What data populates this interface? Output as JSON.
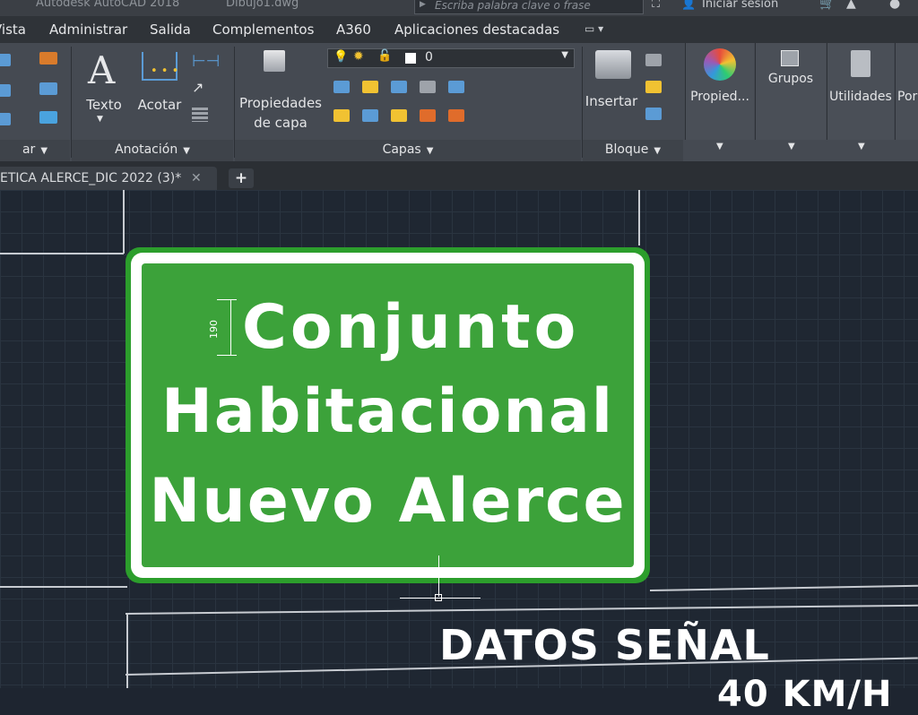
{
  "titlebar": {
    "app_name": "Autodesk AutoCAD 2018",
    "file_name": "Dibujo1.dwg",
    "search_placeholder": "Escriba palabra clave o frase",
    "signin_label": "Iniciar sesión"
  },
  "menu": {
    "items": [
      "Vista",
      "Administrar",
      "Salida",
      "Complementos",
      "A360",
      "Aplicaciones destacadas"
    ]
  },
  "ribbon": {
    "draw_panel_title": "ar",
    "annotation": {
      "title": "Anotación",
      "text_label": "Texto",
      "dimension_label": "Acotar"
    },
    "layers": {
      "title": "Capas",
      "properties_label_line1": "Propiedades",
      "properties_label_line2": "de capa",
      "current_layer": "0"
    },
    "block": {
      "title": "Bloque",
      "insert_label": "Insertar"
    },
    "properties_label": "Propied...",
    "groups_label": "Grupos",
    "utilities_label": "Utilidades",
    "portapapeles_label": "Por"
  },
  "tabs": {
    "document_tab": "ETICA ALERCE_DIC 2022 (3)*",
    "close_symbol": "✕",
    "new_tab_symbol": "+"
  },
  "drawing": {
    "sign_lines": [
      "Conjunto",
      "Habitacional",
      "Nuevo Alerce"
    ],
    "dimension_value": "190",
    "table_title": "DATOS SEÑAL",
    "partial_text": "40 KM/H"
  },
  "colors": {
    "sign_green": "#3ca23a",
    "sign_border": "#ffffff",
    "model_background": "#1f2732",
    "ribbon_background": "#454a52"
  }
}
